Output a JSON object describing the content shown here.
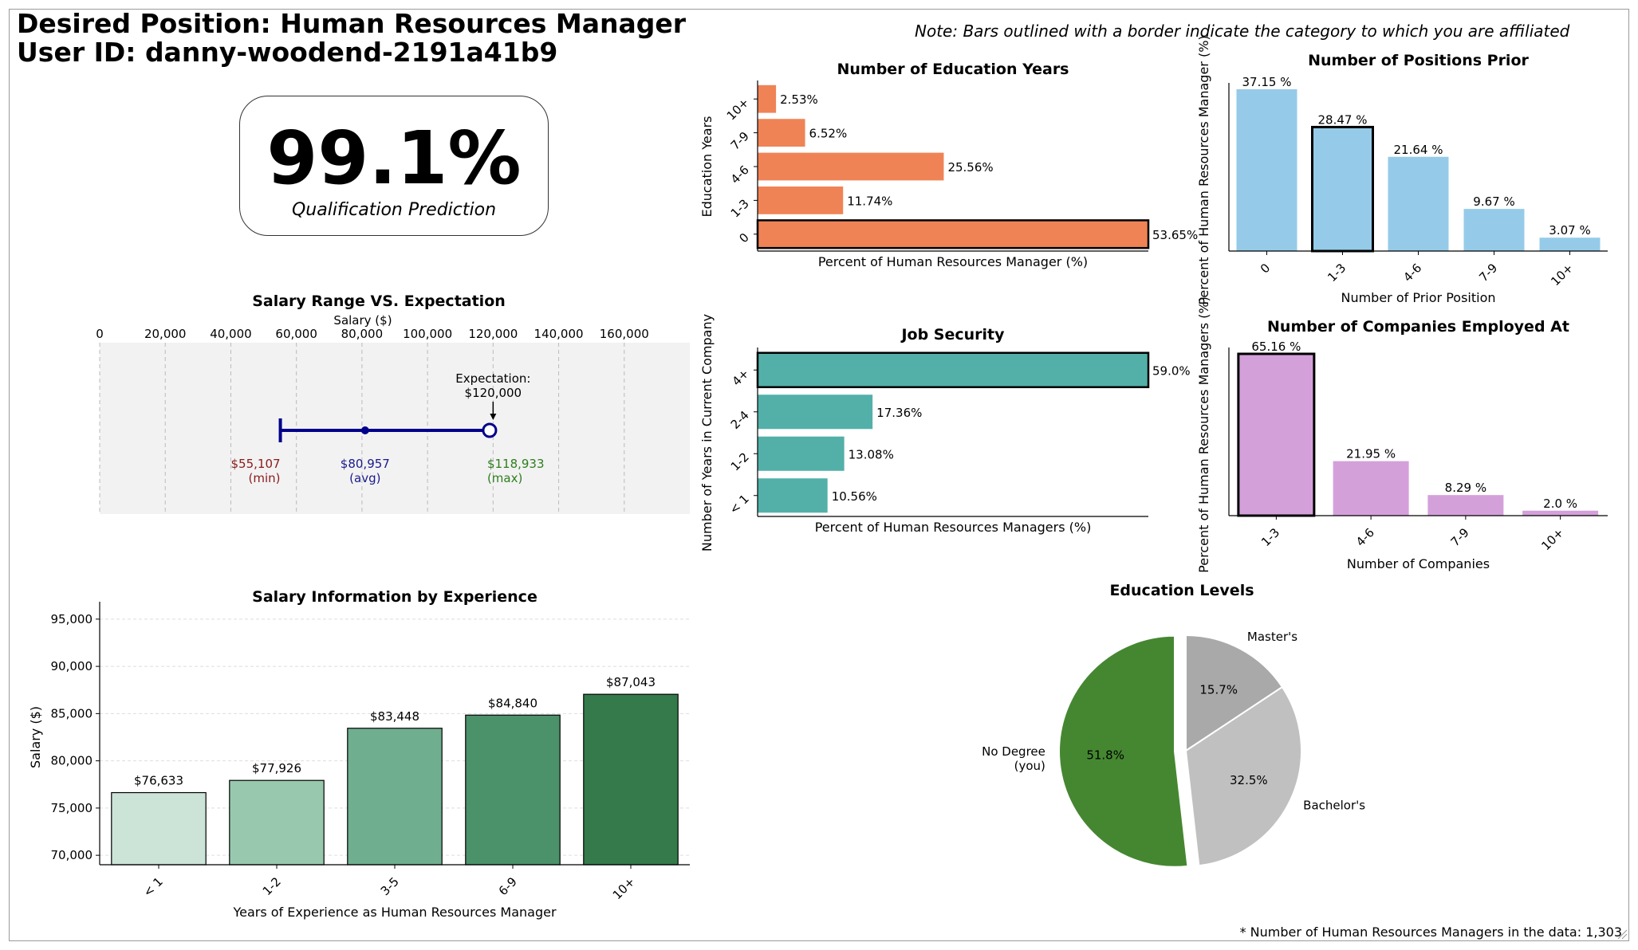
{
  "header": {
    "title": "Desired Position: Human Resources Manager",
    "user": "User ID: danny-woodend-2191a41b9",
    "note": "Note: Bars outlined with a border indicate the category to which you are affiliated"
  },
  "prediction": {
    "value": "99.1%",
    "label": "Qualification Prediction"
  },
  "footer_note": "* Number of Human Resources Managers in the data: 1,303",
  "chart_data": [
    {
      "id": "salary_range",
      "type": "range",
      "title": "Salary Range VS. Expectation",
      "xlabel": "Salary ($)",
      "xlim": [
        0,
        180000
      ],
      "ticks": [
        0,
        20000,
        40000,
        60000,
        80000,
        100000,
        120000,
        140000,
        160000
      ],
      "tick_labels": [
        "0",
        "20,000",
        "40,000",
        "60,000",
        "80,000",
        "100,000",
        "120,000",
        "140,000",
        "160,000"
      ],
      "min": 55107,
      "avg": 80957,
      "max": 118933,
      "expectation": 120000,
      "min_label": [
        "$55,107",
        "(min)"
      ],
      "avg_label": [
        "$80,957",
        "(avg)"
      ],
      "max_label": [
        "$118,933",
        "(max)"
      ],
      "expectation_label": [
        "Expectation:",
        "$120,000"
      ],
      "colors": {
        "line": "#00008b",
        "min": "#8b1a1a",
        "avg": "#1a1a8b",
        "max": "#2e7d1e",
        "bg": "#f2f2f2"
      }
    },
    {
      "id": "salary_by_experience",
      "type": "bar",
      "title": "Salary Information by Experience",
      "xlabel": "Years of Experience as Human Resources Manager",
      "ylabel": "Salary ($)",
      "ylim": [
        69000,
        96000
      ],
      "yticks": [
        70000,
        75000,
        80000,
        85000,
        90000,
        95000
      ],
      "ytick_labels": [
        "70,000",
        "75,000",
        "80,000",
        "85,000",
        "90,000",
        "95,000"
      ],
      "categories": [
        "< 1",
        "1-2",
        "3-5",
        "6-9",
        "10+"
      ],
      "values": [
        76633,
        77926,
        83448,
        84840,
        87043
      ],
      "labels": [
        "$76,633",
        "$77,926",
        "$83,448",
        "$84,840",
        "$87,043"
      ],
      "colors": [
        "#cce3d8",
        "#98c9af",
        "#6fae8e",
        "#4b9169",
        "#357a4b"
      ]
    },
    {
      "id": "education_years",
      "type": "barh",
      "title": "Number of Education Years",
      "xlabel": "Percent of Human Resources Manager (%)",
      "ylabel": "Education Years",
      "categories": [
        "0",
        "1-3",
        "4-6",
        "7-9",
        "10+"
      ],
      "values": [
        53.65,
        11.74,
        25.56,
        6.52,
        2.53
      ],
      "labels": [
        "53.65%",
        "11.74%",
        "25.56%",
        "6.52%",
        "2.53%"
      ],
      "highlight": "0",
      "color": "#ef8356"
    },
    {
      "id": "job_security",
      "type": "barh",
      "title": "Job Security",
      "xlabel": "Percent of Human Resources Managers (%)",
      "ylabel": "Number of Years in Current Company",
      "categories": [
        "< 1",
        "1-2",
        "2-4",
        "4+"
      ],
      "values": [
        10.56,
        13.08,
        17.36,
        59.0
      ],
      "labels": [
        "10.56%",
        "13.08%",
        "17.36%",
        "59.0%"
      ],
      "highlight": "4+",
      "color": "#52b0a8"
    },
    {
      "id": "positions_prior",
      "type": "bar",
      "title": "Number of Positions Prior",
      "xlabel": "Number of Prior Position",
      "ylabel": "Percent of Human Resources Manager (%)",
      "categories": [
        "0",
        "1-3",
        "4-6",
        "7-9",
        "10+"
      ],
      "values": [
        37.15,
        28.47,
        21.64,
        9.67,
        3.07
      ],
      "labels": [
        "37.15 %",
        "28.47 %",
        "21.64 %",
        "9.67 %",
        "3.07 %"
      ],
      "highlight": "1-3",
      "color": "#95cbe8"
    },
    {
      "id": "companies_employed",
      "type": "bar",
      "title": "Number of Companies Employed At",
      "xlabel": "Number of Companies",
      "ylabel": "Percent of Human Resources Managers (%)",
      "categories": [
        "1-3",
        "4-6",
        "7-9",
        "10+"
      ],
      "values": [
        65.16,
        21.95,
        8.29,
        2.0
      ],
      "labels": [
        "65.16 %",
        "21.95 %",
        "8.29 %",
        "2.0 %"
      ],
      "highlight": "1-3",
      "color": "#d4a0da"
    },
    {
      "id": "education_levels",
      "type": "pie",
      "title": "Education Levels",
      "slices": [
        {
          "label": "Master's",
          "value": 15.7,
          "pct": "15.7%",
          "color": "#a9a9a9"
        },
        {
          "label": "Bachelor's",
          "value": 32.5,
          "pct": "32.5%",
          "color": "#c0c0c0"
        },
        {
          "label": "No Degree\n(you)",
          "value": 51.8,
          "pct": "51.8%",
          "color": "#458731",
          "explode": true
        }
      ]
    }
  ]
}
